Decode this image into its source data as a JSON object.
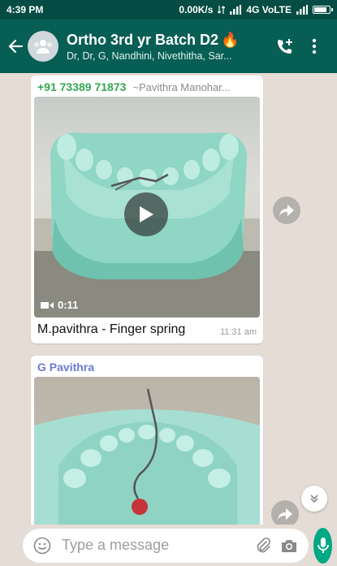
{
  "status_bar": {
    "time": "4:39 PM",
    "net_speed": "0.00K/s",
    "network": "4G VoLTE",
    "battery_level": 0.9
  },
  "header": {
    "title": "Ortho 3rd yr Batch D2",
    "title_emoji": "🔥",
    "subtitle": "Dr, Dr, G, Nandhini, Nivethitha, Sar..."
  },
  "messages": [
    {
      "sender_number": "+91 73389 71873",
      "sender_alias": "~Pavithra Manohar...",
      "media_type": "video",
      "duration": "0:11",
      "caption": "M.pavithra - Finger spring",
      "time": "11:31 am"
    },
    {
      "sender_name": "G Pavithra",
      "media_type": "image"
    }
  ],
  "composer": {
    "placeholder": "Type a message"
  },
  "colors": {
    "primary": "#075e54",
    "status_bar": "#054d44",
    "accent": "#00a884",
    "chat_bg": "#e5ddd5",
    "sender_number": "#35a853",
    "sender_name": "#6b7bd6"
  },
  "icons": [
    "back-arrow-icon",
    "group-avatar-icon",
    "fire-emoji",
    "add-call-icon",
    "more-vert-icon",
    "play-icon",
    "video-camera-icon",
    "forward-icon",
    "double-chevron-down-icon",
    "emoji-icon",
    "attach-icon",
    "camera-icon",
    "mic-icon"
  ]
}
